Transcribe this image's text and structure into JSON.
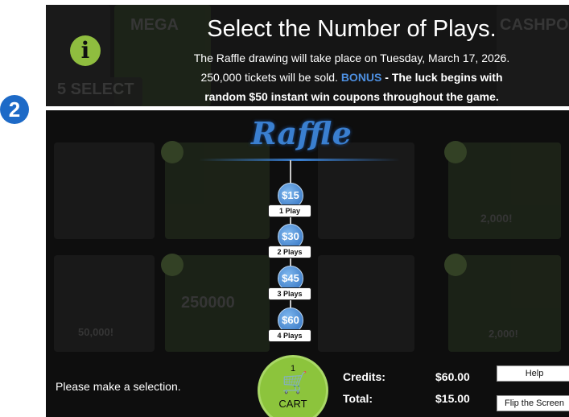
{
  "step_number": "2",
  "info": {
    "icon": "info-icon",
    "icon_glyph": "i",
    "title": "Select the Number of Plays.",
    "line1": "The Raffle drawing will take place on Tuesday, March 17, 2026.",
    "line2_prefix": "250,000 tickets will be sold.",
    "bonus_label": "BONUS",
    "line2_suffix": "- The luck begins with",
    "line3": "random $50 instant win coupons throughout the game."
  },
  "background_tiles": {
    "top": [
      "MEGA",
      "CASHPO",
      "5 SELECT"
    ],
    "game": [
      "2,000!",
      "250000",
      "50,000!",
      "2,000!"
    ]
  },
  "raffle": {
    "logo": "Raffle",
    "options": [
      {
        "price": "$15",
        "label": "1 Play"
      },
      {
        "price": "$30",
        "label": "2 Plays"
      },
      {
        "price": "$45",
        "label": "3 Plays"
      },
      {
        "price": "$60",
        "label": "4 Plays"
      }
    ]
  },
  "footer": {
    "prompt": "Please make a selection.",
    "cart_label": "CART",
    "cart_count": "1",
    "credits_label": "Credits:",
    "credits_value": "$60.00",
    "total_label": "Total:",
    "total_value": "$15.00",
    "help_label": "Help",
    "flip_label": "Flip the Screen"
  },
  "colors": {
    "accent_green": "#8cc43c",
    "accent_blue": "#2f6fbf",
    "badge_blue": "#1d6ac7"
  }
}
